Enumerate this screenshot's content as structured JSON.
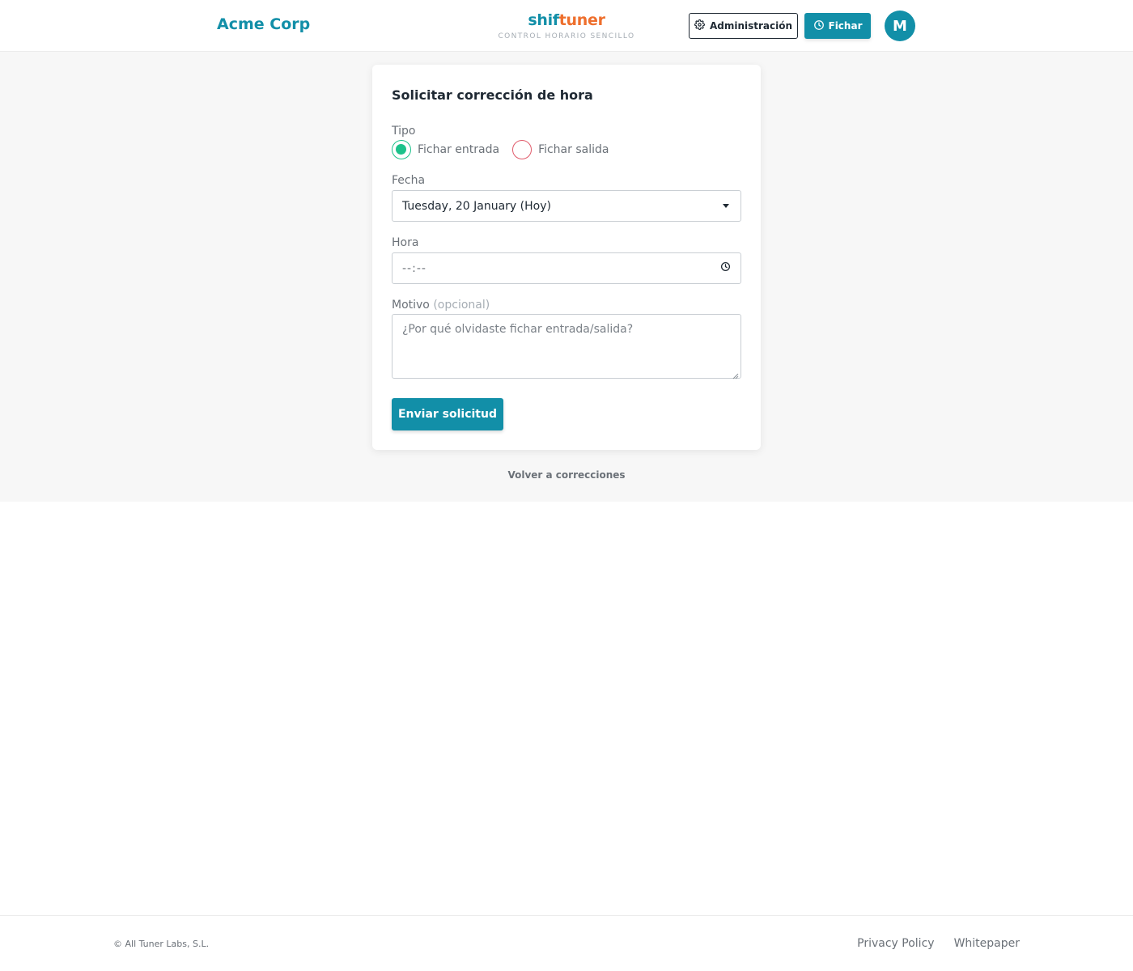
{
  "header": {
    "company": "Acme Corp",
    "brand_part1": "shif",
    "brand_part2": "tuner",
    "brand_tagline": "CONTROL HORARIO SENCILLO",
    "admin_label": "Administración",
    "fichar_label": "Fichar",
    "avatar_initial": "M"
  },
  "form": {
    "title": "Solicitar corrección de hora",
    "tipo_label": "Tipo",
    "options": [
      {
        "label": "Fichar entrada",
        "checked": true
      },
      {
        "label": "Fichar salida",
        "checked": false
      }
    ],
    "fecha_label": "Fecha",
    "fecha_value": "Tuesday, 20 January (Hoy)",
    "hora_label": "Hora",
    "hora_placeholder": "--:--",
    "motivo_label": "Motivo",
    "motivo_optional": "(opcional)",
    "motivo_placeholder": "¿Por qué olvidaste fichar entrada/salida?",
    "submit_label": "Enviar solicitud",
    "back_link": "Volver a correcciones"
  },
  "footer": {
    "copyright": "© All Tuner Labs, S.L.",
    "links": [
      "Privacy Policy",
      "Whitepaper"
    ]
  },
  "colors": {
    "primary": "#128fa8",
    "accent": "#ee6f2d",
    "radio_checked": "#1cc28b",
    "radio_unchecked": "#e05a6a"
  }
}
